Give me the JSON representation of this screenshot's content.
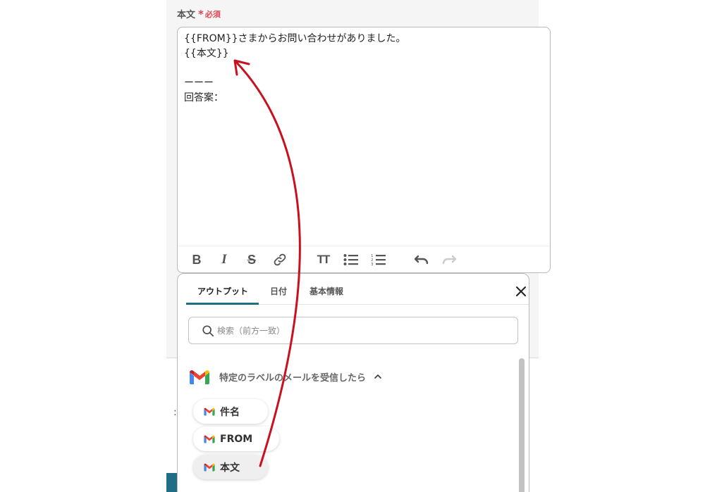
{
  "field": {
    "label": "本文",
    "required_star": "*",
    "required_text": "必須"
  },
  "editor": {
    "lines": [
      "{{FROM}}さまからお問い合わせがありました。",
      "{{本文}}",
      "",
      "ーーー",
      "回答案："
    ]
  },
  "toolbar": {
    "bold": "B",
    "italic": "I",
    "strike": "S",
    "size": "TT"
  },
  "popup": {
    "tabs": [
      {
        "label": "アウトプット",
        "active": true
      },
      {
        "label": "日付",
        "active": false
      },
      {
        "label": "基本情報",
        "active": false
      }
    ],
    "search_placeholder": "検索（前方一致）",
    "section_title": "特定のラベルのメールを受信したら",
    "chips": [
      {
        "label": "件名"
      },
      {
        "label": "FROM"
      },
      {
        "label": "本文"
      }
    ]
  },
  "colors": {
    "accent": "#1f6e86",
    "required": "#e0454f",
    "arrow": "#c8101e"
  },
  "icons": [
    "bold-icon",
    "italic-icon",
    "strikethrough-icon",
    "link-icon",
    "text-size-icon",
    "bullet-list-icon",
    "numbered-list-icon",
    "undo-icon",
    "redo-icon",
    "close-icon",
    "search-icon",
    "gmail-icon",
    "chevron-up-icon"
  ]
}
